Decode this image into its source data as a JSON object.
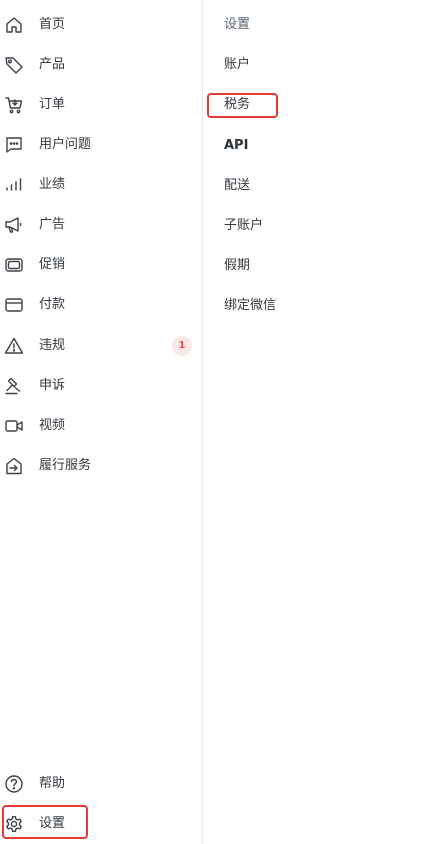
{
  "left_nav": {
    "items": [
      {
        "label": "首页",
        "icon": "home-icon"
      },
      {
        "label": "产品",
        "icon": "tag-icon"
      },
      {
        "label": "订单",
        "icon": "cart-icon"
      },
      {
        "label": "用户问题",
        "icon": "chat-icon"
      },
      {
        "label": "业绩",
        "icon": "bar-chart-icon"
      },
      {
        "label": "广告",
        "icon": "megaphone-icon"
      },
      {
        "label": "促销",
        "icon": "promo-icon"
      },
      {
        "label": "付款",
        "icon": "card-icon"
      },
      {
        "label": "违规",
        "icon": "warning-icon",
        "badge": "1"
      },
      {
        "label": "申诉",
        "icon": "gavel-icon"
      },
      {
        "label": "视频",
        "icon": "video-icon"
      },
      {
        "label": "履行服务",
        "icon": "fulfillment-icon"
      }
    ],
    "bottom_items": [
      {
        "label": "帮助",
        "icon": "help-icon"
      },
      {
        "label": "设置",
        "icon": "gear-icon"
      }
    ]
  },
  "sub_nav": {
    "header": "设置",
    "items": [
      "账户",
      "税务",
      "API",
      "配送",
      "子账户",
      "假期",
      "绑定微信"
    ]
  },
  "colors": {
    "highlight": "#e53935",
    "badge_bg": "#fde6e6",
    "badge_text": "#e5484d",
    "text": "#333a40",
    "divider": "#e6e8eb"
  }
}
